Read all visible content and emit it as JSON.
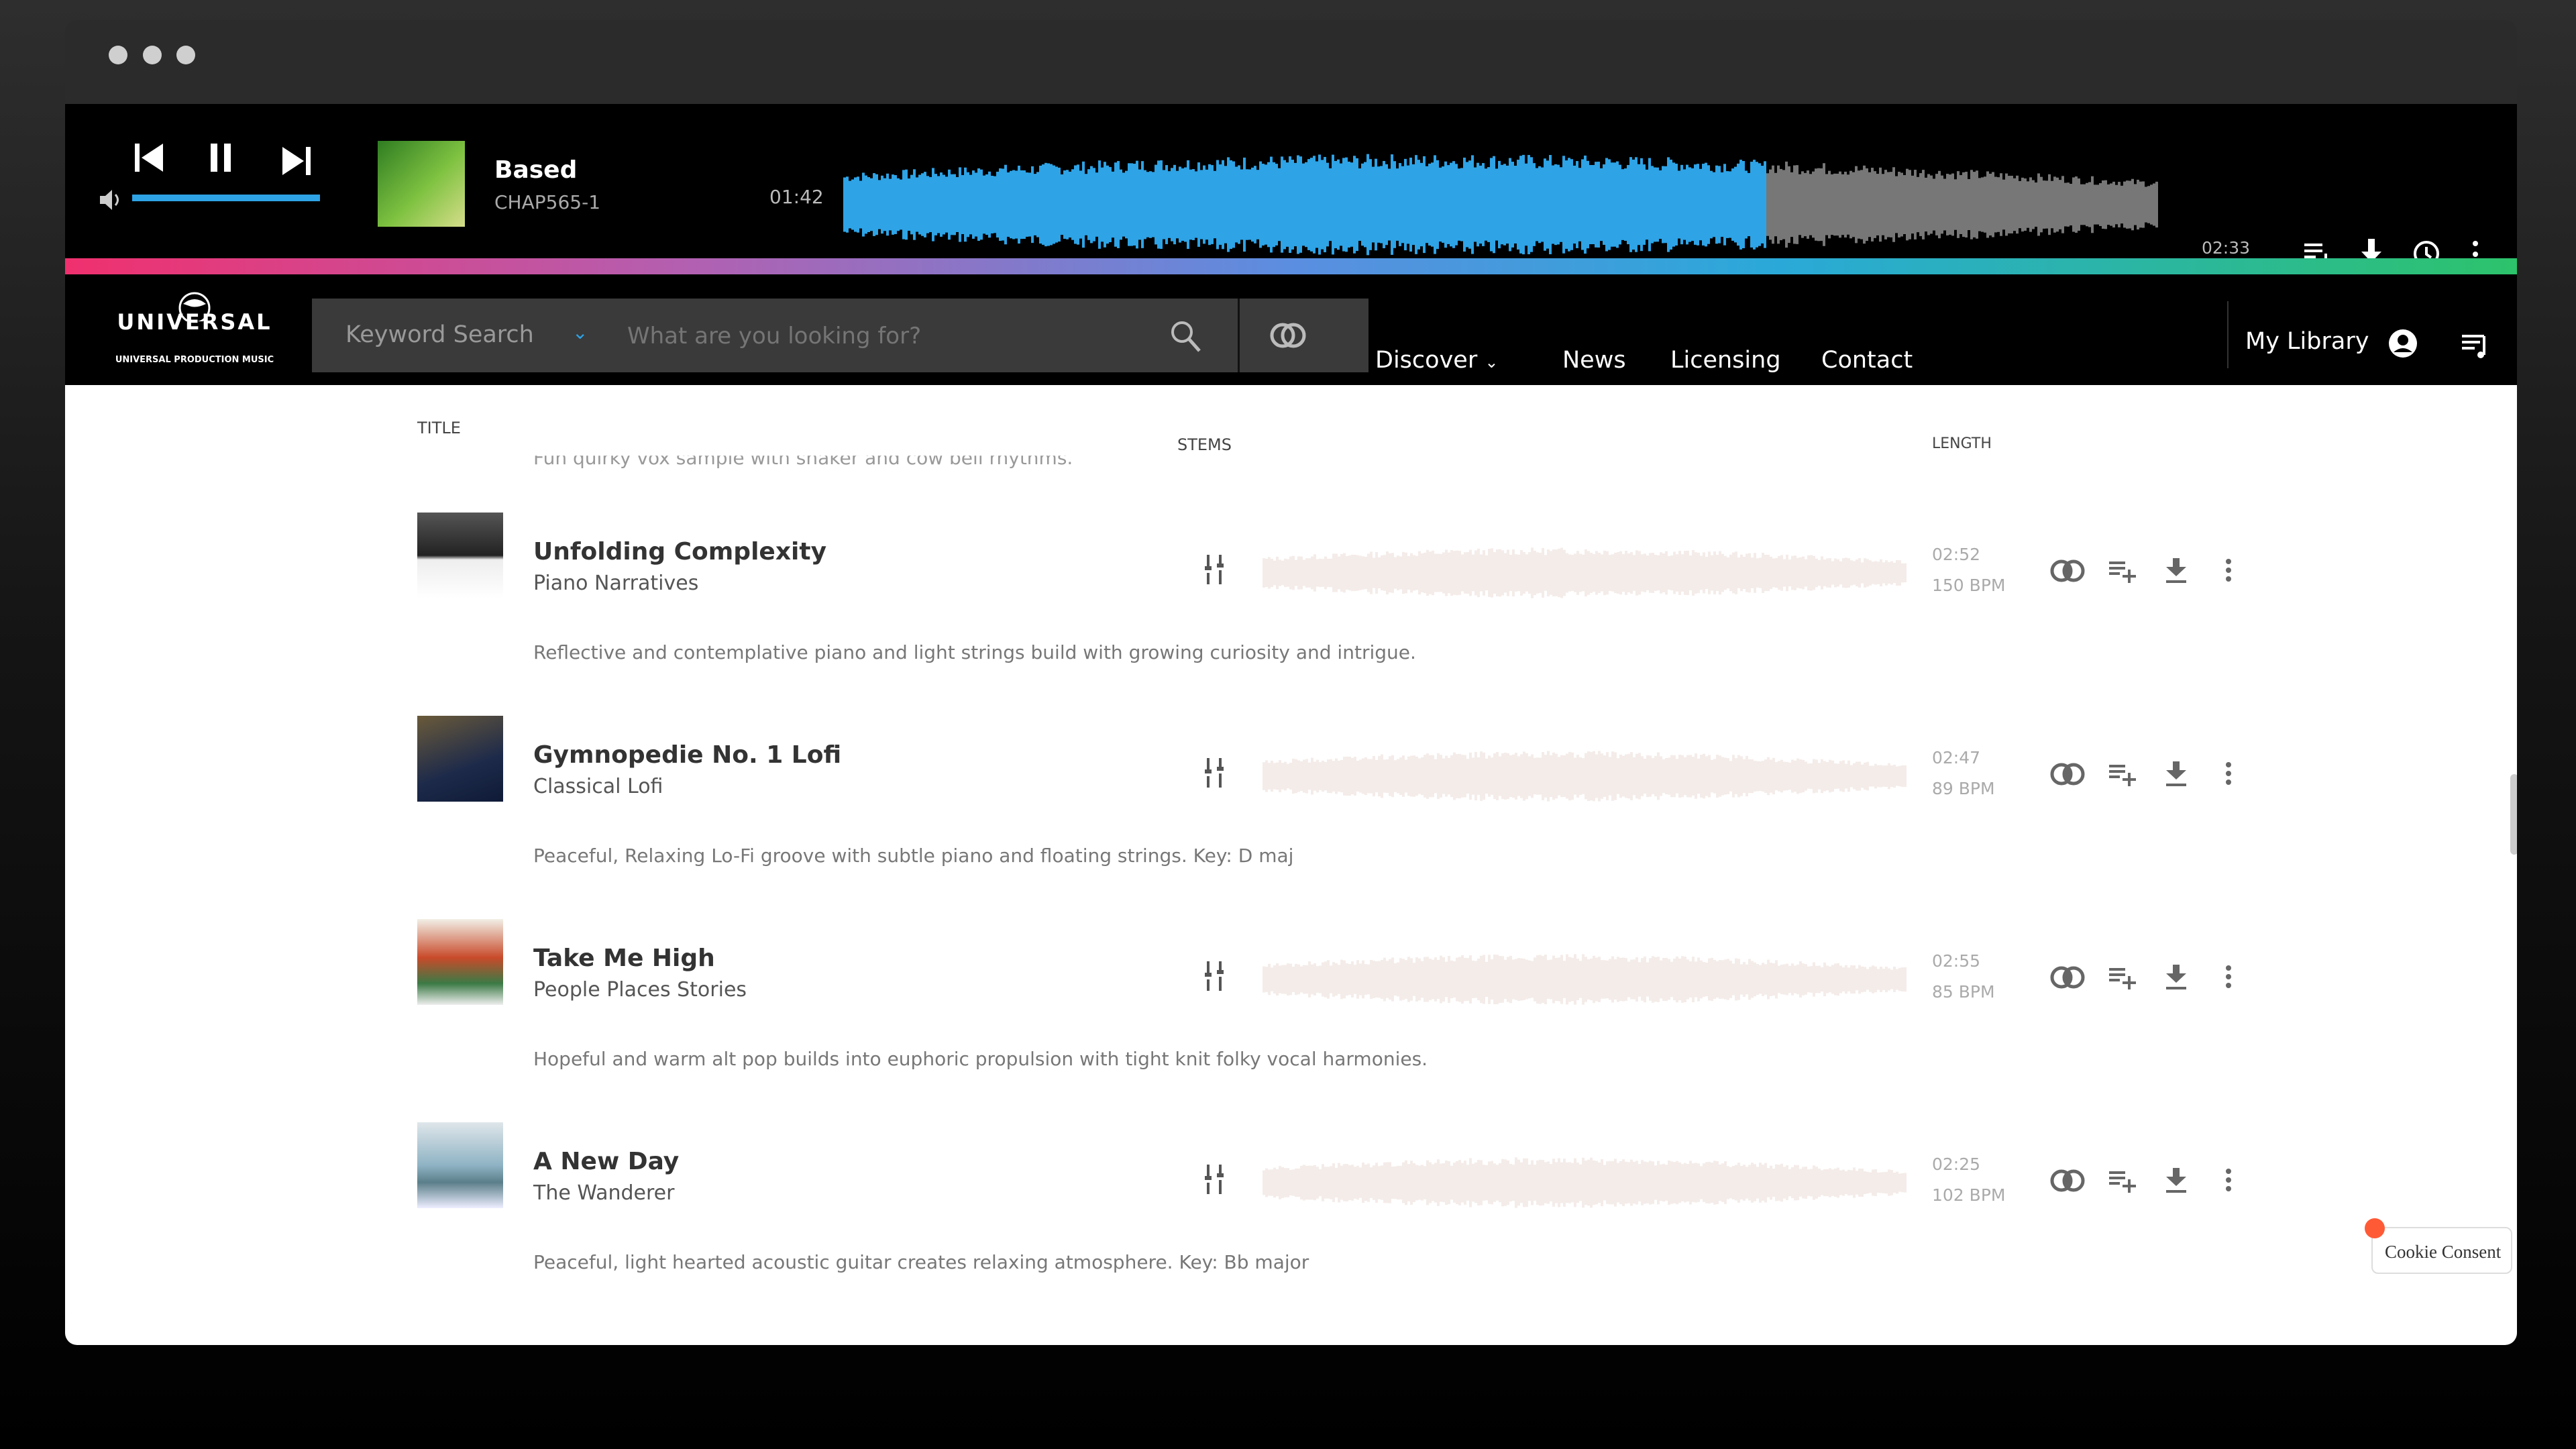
{
  "player": {
    "title": "Based",
    "code": "CHAP565-1",
    "elapsed": "01:42",
    "duration": "02:33",
    "progress": 0.7,
    "volume": 1.0,
    "accent": "#2ea3e6"
  },
  "nav": {
    "logo": "UNIVERSAL",
    "logo_sub": "UNIVERSAL PRODUCTION MUSIC",
    "search_mode": "Keyword Search",
    "search_placeholder": "What are you looking for?",
    "links": [
      "Discover",
      "News",
      "Licensing",
      "Contact"
    ],
    "my_library": "My Library"
  },
  "table": {
    "headers": {
      "title": "TITLE",
      "stems": "STEMS",
      "length": "LENGTH"
    },
    "partial_desc": "Fun quirky vox sample with shaker and cow bell rhythms.",
    "rows": [
      {
        "title": "Unfolding Complexity",
        "artist": "Piano Narratives",
        "desc": "Reflective and contemplative piano and light strings build with growing curiosity and intrigue.",
        "length": "02:52",
        "bpm": "150 BPM"
      },
      {
        "title": "Gymnopedie No. 1 Lofi",
        "artist": "Classical Lofi",
        "desc": "Peaceful, Relaxing Lo-Fi groove with subtle piano and floating strings. Key: D maj",
        "length": "02:47",
        "bpm": "89 BPM"
      },
      {
        "title": "Take Me High",
        "artist": "People Places Stories",
        "desc": "Hopeful and warm alt pop builds into euphoric propulsion with tight knit folky vocal harmonies.",
        "length": "02:55",
        "bpm": "85 BPM"
      },
      {
        "title": "A New Day",
        "artist": "The Wanderer",
        "desc": "Peaceful, light hearted acoustic guitar creates relaxing atmosphere. Key: Bb major",
        "length": "02:25",
        "bpm": "102 BPM"
      }
    ]
  },
  "cookie": {
    "label": "Cookie Consent",
    "dot_color": "#ff5a36"
  }
}
